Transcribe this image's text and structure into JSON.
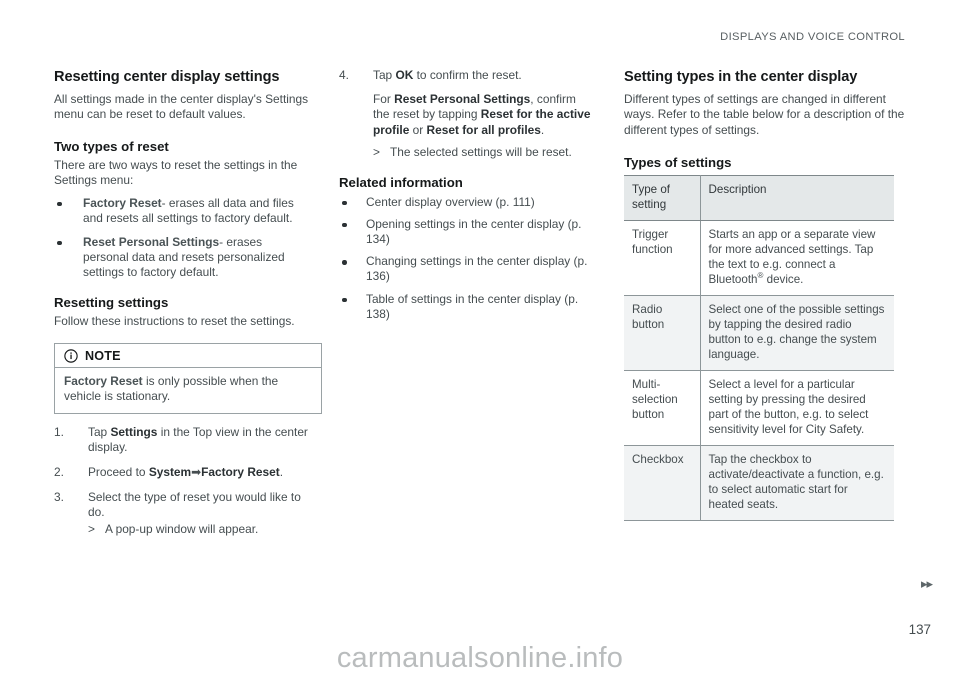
{
  "header": {
    "running_title": "DISPLAYS AND VOICE CONTROL"
  },
  "column_left": {
    "title": "Resetting center display settings",
    "intro": "All settings made in the center display's Settings menu can be reset to default values.",
    "two_types_heading": "Two types of reset",
    "two_types_intro": "There are two ways to reset the settings in the Settings menu:",
    "reset_types": [
      {
        "term": "Factory Reset",
        "text": "- erases all data and files and resets all settings to factory default."
      },
      {
        "term": "Reset Personal Settings",
        "text": "- erases personal data and resets personalized settings to factory default."
      }
    ],
    "resetting_heading": "Resetting settings",
    "resetting_intro": "Follow these instructions to reset the settings.",
    "note": {
      "icon": "info-circle-icon",
      "title": "NOTE",
      "term": "Factory Reset",
      "text": " is only possible when the vehicle is stationary."
    },
    "steps": [
      {
        "num": "1.",
        "pre": "Tap ",
        "term": "Settings",
        "post": " in the Top view in the center display."
      },
      {
        "num": "2.",
        "pre": "Proceed to ",
        "term": "System",
        "arrow": "➡",
        "term2": "Factory Reset",
        "post": "."
      },
      {
        "num": "3.",
        "pre": "Select the type of reset you would like to do.",
        "substep_marker": ">",
        "substep": "A pop-up window will appear."
      }
    ]
  },
  "column_middle": {
    "step4": {
      "num": "4.",
      "pre": "Tap ",
      "term": "OK",
      "post": " to confirm the reset."
    },
    "step4_para": {
      "t1": "For ",
      "term1": "Reset Personal Settings",
      "t2": ", confirm the reset by tapping ",
      "term2": "Reset for the active profile",
      "t3": " or ",
      "term3": "Reset for all profiles",
      "t4": "."
    },
    "step4_sub_marker": ">",
    "step4_sub": "The selected settings will be reset.",
    "related_heading": "Related information",
    "related_links": [
      "Center display overview (p. 111)",
      "Opening settings in the center display (p. 134)",
      "Changing settings in the center display (p. 136)",
      "Table of settings in the center display (p. 138)"
    ]
  },
  "column_right": {
    "title": "Setting types in the center display",
    "intro": "Different types of settings are changed in different ways. Refer to the table below for a description of the different types of settings.",
    "table_caption": "Types of settings",
    "table": {
      "headers": [
        "Type of setting",
        "Description"
      ],
      "rows": [
        {
          "type": "Trigger function",
          "desc_pre": "Starts an app or a separate view for more advanced settings. Tap the text to e.g. connect a Bluetooth",
          "desc_sup": "®",
          "desc_post": " device.",
          "shaded": false
        },
        {
          "type": "Radio button",
          "desc_pre": "Select one of the possible settings by tapping the desired radio button to e.g. change the system language.",
          "desc_sup": "",
          "desc_post": "",
          "shaded": true
        },
        {
          "type": "Multi-selection button",
          "desc_pre": "Select a level for a particular setting by pressing the desired part of the button, e.g. to select sensitivity level for City Safety.",
          "desc_sup": "",
          "desc_post": "",
          "shaded": false
        },
        {
          "type": "Checkbox",
          "desc_pre": "Tap the checkbox to activate/deactivate a function, e.g. to select automatic start for heated seats.",
          "desc_sup": "",
          "desc_post": "",
          "shaded": true
        }
      ]
    }
  },
  "footer": {
    "nav_arrows": "▸▸",
    "page_number": "137",
    "watermark": "carmanualsonline.info"
  },
  "colors": {
    "body_text": "#454d50",
    "heading_text": "#16191a",
    "term_text": "#4a5356",
    "table_header_bg": "#e4e8e9",
    "table_shaded_bg": "#f1f3f4",
    "rule": "#8d9699",
    "watermark": "#b9bcbd"
  }
}
